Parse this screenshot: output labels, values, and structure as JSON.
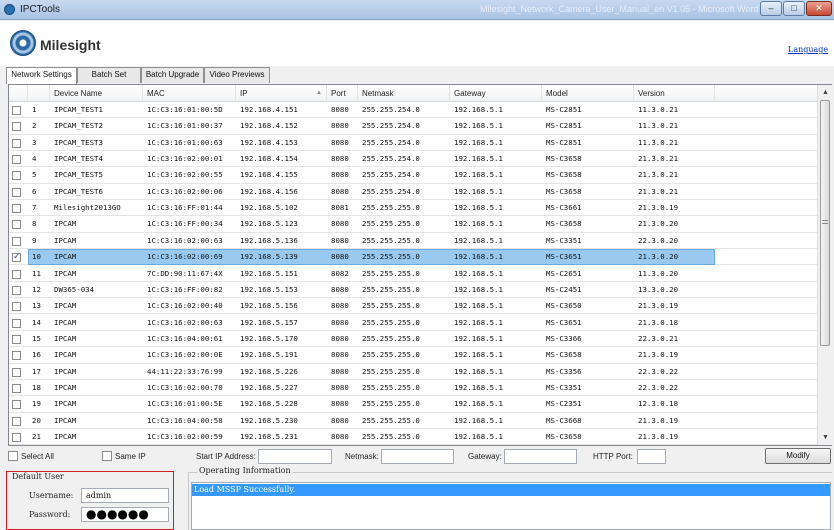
{
  "window": {
    "title": "IPCTools",
    "ghost_text": "Milesight_Network_Camera_User_Manual_en V1.05 - Microsoft Word",
    "min_label": "–",
    "max_label": "□",
    "close_label": "✕"
  },
  "header": {
    "logo_text": "Milesight",
    "language_link": "Language"
  },
  "tabs": [
    {
      "label": "Network Settings",
      "active": true
    },
    {
      "label": "Batch Set",
      "active": false
    },
    {
      "label": "Batch Upgrade",
      "active": false
    },
    {
      "label": "Video Previews",
      "active": false
    }
  ],
  "grid": {
    "columns": [
      "",
      "Device Name",
      "MAC",
      "IP",
      "Port",
      "Netmask",
      "Gateway",
      "Model",
      "Version"
    ],
    "rows": [
      {
        "no": "1",
        "name": "IPCAM_TEST1",
        "mac": "1C:C3:16:01:00:5D",
        "ip": "192.168.4.151",
        "port": "8080",
        "netmask": "255.255.254.0",
        "gateway": "192.168.5.1",
        "model": "MS-C2851",
        "version": "11.3.0.21",
        "checked": false,
        "selected": false
      },
      {
        "no": "2",
        "name": "IPCAM_TEST2",
        "mac": "1C:C3:16:01:00:37",
        "ip": "192.168.4.152",
        "port": "8080",
        "netmask": "255.255.254.0",
        "gateway": "192.168.5.1",
        "model": "MS-C2851",
        "version": "11.3.0.21",
        "checked": false,
        "selected": false
      },
      {
        "no": "3",
        "name": "IPCAM_TEST3",
        "mac": "1C:C3:16:01:00:63",
        "ip": "192.168.4.153",
        "port": "8080",
        "netmask": "255.255.254.0",
        "gateway": "192.168.5.1",
        "model": "MS-C2851",
        "version": "11.3.0.21",
        "checked": false,
        "selected": false
      },
      {
        "no": "4",
        "name": "IPCAM_TEST4",
        "mac": "1C:C3:16:02:00:01",
        "ip": "192.168.4.154",
        "port": "8080",
        "netmask": "255.255.254.0",
        "gateway": "192.168.5.1",
        "model": "MS-C3658",
        "version": "21.3.0.21",
        "checked": false,
        "selected": false
      },
      {
        "no": "5",
        "name": "IPCAM_TEST5",
        "mac": "1C:C3:16:02:00:55",
        "ip": "192.168.4.155",
        "port": "8080",
        "netmask": "255.255.254.0",
        "gateway": "192.168.5.1",
        "model": "MS-C3658",
        "version": "21.3.0.21",
        "checked": false,
        "selected": false
      },
      {
        "no": "6",
        "name": "IPCAM_TEST6",
        "mac": "1C:C3:16:02:00:06",
        "ip": "192.168.4.156",
        "port": "8080",
        "netmask": "255.255.254.0",
        "gateway": "192.168.5.1",
        "model": "MS-C3658",
        "version": "21.3.0.21",
        "checked": false,
        "selected": false
      },
      {
        "no": "7",
        "name": "Milesight2013GO",
        "mac": "1C:C3:16:FF:01:44",
        "ip": "192.168.5.102",
        "port": "8081",
        "netmask": "255.255.255.0",
        "gateway": "192.168.5.1",
        "model": "MS-C3661",
        "version": "21.3.0.19",
        "checked": false,
        "selected": false
      },
      {
        "no": "8",
        "name": "IPCAM",
        "mac": "1C:C3:16:FF:00:34",
        "ip": "192.168.5.123",
        "port": "8080",
        "netmask": "255.255.255.0",
        "gateway": "192.168.5.1",
        "model": "MS-C3658",
        "version": "21.3.0.20",
        "checked": false,
        "selected": false
      },
      {
        "no": "9",
        "name": "IPCAM",
        "mac": "1C:C3:16:02:00:63",
        "ip": "192.168.5.136",
        "port": "8080",
        "netmask": "255.255.255.0",
        "gateway": "192.168.5.1",
        "model": "MS-C3351",
        "version": "22.3.0.20",
        "checked": false,
        "selected": false
      },
      {
        "no": "10",
        "name": "IPCAM",
        "mac": "1C:C3:16:02:00:69",
        "ip": "192.168.5.139",
        "port": "8080",
        "netmask": "255.255.255.0",
        "gateway": "192.168.5.1",
        "model": "MS-C3651",
        "version": "21.3.0.20",
        "checked": true,
        "selected": true
      },
      {
        "no": "11",
        "name": "IPCAM",
        "mac": "7C:DD:90:11:67:4X",
        "ip": "192.168.5.151",
        "port": "8082",
        "netmask": "255.255.255.0",
        "gateway": "192.168.5.1",
        "model": "MS-C2651",
        "version": "11.3.0.20",
        "checked": false,
        "selected": false
      },
      {
        "no": "12",
        "name": "DW365-034",
        "mac": "1C:C3:16:FF:00:82",
        "ip": "192.168.5.153",
        "port": "8080",
        "netmask": "255.255.255.0",
        "gateway": "192.168.5.1",
        "model": "MS-C2451",
        "version": "13.3.0.20",
        "checked": false,
        "selected": false
      },
      {
        "no": "13",
        "name": "IPCAM",
        "mac": "1C:C3:16:02:00:40",
        "ip": "192.168.5.156",
        "port": "8080",
        "netmask": "255.255.255.0",
        "gateway": "192.168.5.1",
        "model": "MS-C3650",
        "version": "21.3.0.19",
        "checked": false,
        "selected": false
      },
      {
        "no": "14",
        "name": "IPCAM",
        "mac": "1C:C3:16:02:00:63",
        "ip": "192.168.5.157",
        "port": "8080",
        "netmask": "255.255.255.0",
        "gateway": "192.168.5.1",
        "model": "MS-C3651",
        "version": "21.3.0.18",
        "checked": false,
        "selected": false
      },
      {
        "no": "15",
        "name": "IPCAM",
        "mac": "1C:C3:16:04:00:61",
        "ip": "192.168.5.170",
        "port": "8080",
        "netmask": "255.255.255.0",
        "gateway": "192.168.5.1",
        "model": "MS-C3366",
        "version": "22.3.0.21",
        "checked": false,
        "selected": false
      },
      {
        "no": "16",
        "name": "IPCAM",
        "mac": "1C:C3:16:02:00:0E",
        "ip": "192.168.5.191",
        "port": "8080",
        "netmask": "255.255.255.0",
        "gateway": "192.168.5.1",
        "model": "MS-C3658",
        "version": "21.3.0.19",
        "checked": false,
        "selected": false
      },
      {
        "no": "17",
        "name": "IPCAM",
        "mac": "44:11:22:33:76:99",
        "ip": "192.168.5.226",
        "port": "8080",
        "netmask": "255.255.255.0",
        "gateway": "192.168.5.1",
        "model": "MS-C3356",
        "version": "22.3.0.22",
        "checked": false,
        "selected": false
      },
      {
        "no": "18",
        "name": "IPCAM",
        "mac": "1C:C3:16:02:00:70",
        "ip": "192.168.5.227",
        "port": "8080",
        "netmask": "255.255.255.0",
        "gateway": "192.168.5.1",
        "model": "MS-C3351",
        "version": "22.3.0.22",
        "checked": false,
        "selected": false
      },
      {
        "no": "19",
        "name": "IPCAM",
        "mac": "1C:C3:16:01:00:5E",
        "ip": "192.168.5.228",
        "port": "8080",
        "netmask": "255.255.255.0",
        "gateway": "192.168.5.1",
        "model": "MS-C2351",
        "version": "12.3.0.18",
        "checked": false,
        "selected": false
      },
      {
        "no": "20",
        "name": "IPCAM",
        "mac": "1C:C3:16:04:00:58",
        "ip": "192.168.5.230",
        "port": "8080",
        "netmask": "255.255.255.0",
        "gateway": "192.168.5.1",
        "model": "MS-C3668",
        "version": "21.3.0.19",
        "checked": false,
        "selected": false
      },
      {
        "no": "21",
        "name": "IPCAM",
        "mac": "1C:C3:16:02:00:59",
        "ip": "192.168.5.231",
        "port": "8080",
        "netmask": "255.255.255.0",
        "gateway": "192.168.5.1",
        "model": "MS-C3658",
        "version": "21.3.0.19",
        "checked": false,
        "selected": false
      }
    ]
  },
  "actions": {
    "select_all": "Select All",
    "same_ip": "Same IP",
    "start_ip_label": "Start IP Address:",
    "start_ip_value": "",
    "netmask_label": "Netmask:",
    "netmask_value": "",
    "gateway_label": "Gateway:",
    "gateway_value": "",
    "http_port_label": "HTTP Port:",
    "http_port_value": "",
    "modify_label": "Modify"
  },
  "default_user": {
    "legend": "Default User",
    "username_label": "Username:",
    "username_value": "admin",
    "password_label": "Password:",
    "password_mask": "●●●●●●"
  },
  "operating_info": {
    "legend": "Operating Information",
    "lines": [
      "Load MSSP Successfully."
    ]
  }
}
